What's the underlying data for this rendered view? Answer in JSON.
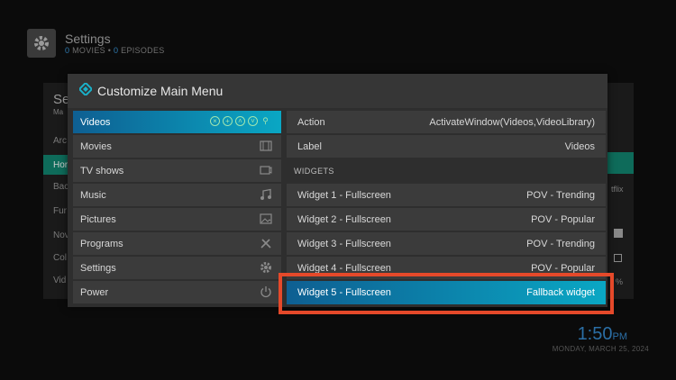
{
  "background": {
    "title": "Settings",
    "subtitle_movies_count": "0",
    "subtitle_movies_label": "MOVIES",
    "subtitle_sep": "•",
    "subtitle_episodes_count": "0",
    "subtitle_episodes_label": "EPISODES",
    "side_items": [
      "Se",
      "Ma",
      "Arc",
      "Hor",
      "Bac",
      "Fur",
      "Nov",
      "Col",
      "Vid"
    ],
    "right_text_1": "tflix",
    "right_text_2": "%"
  },
  "clock": {
    "time": "1:50",
    "ampm": "PM",
    "date": "MONDAY, MARCH 25, 2024"
  },
  "dialog": {
    "title": "Customize Main Menu",
    "menu_items": [
      {
        "label": "Videos",
        "icon": "active-controls"
      },
      {
        "label": "Movies",
        "icon": "film-icon"
      },
      {
        "label": "TV shows",
        "icon": "tv-icon"
      },
      {
        "label": "Music",
        "icon": "music-note-icon"
      },
      {
        "label": "Pictures",
        "icon": "picture-icon"
      },
      {
        "label": "Programs",
        "icon": "tools-icon"
      },
      {
        "label": "Settings",
        "icon": "gear-icon"
      },
      {
        "label": "Power",
        "icon": "power-icon"
      }
    ],
    "action_label": "Action",
    "action_value": "ActivateWindow(Videos,VideoLibrary)",
    "label_label": "Label",
    "label_value": "Videos",
    "widgets_header": "WIDGETS",
    "widgets": [
      {
        "name": "Widget 1 - Fullscreen",
        "value": "POV - Trending"
      },
      {
        "name": "Widget 2 - Fullscreen",
        "value": "POV - Popular"
      },
      {
        "name": "Widget 3 - Fullscreen",
        "value": "POV - Trending"
      },
      {
        "name": "Widget 4 - Fullscreen",
        "value": "POV - Popular"
      },
      {
        "name": "Widget 5 - Fullscreen",
        "value": "Fallback widget"
      }
    ]
  },
  "colors": {
    "accent_start": "#0e5f92",
    "accent_end": "#0aa7c4",
    "highlight_box": "#e5492a",
    "clock": "#2b6fa6"
  }
}
